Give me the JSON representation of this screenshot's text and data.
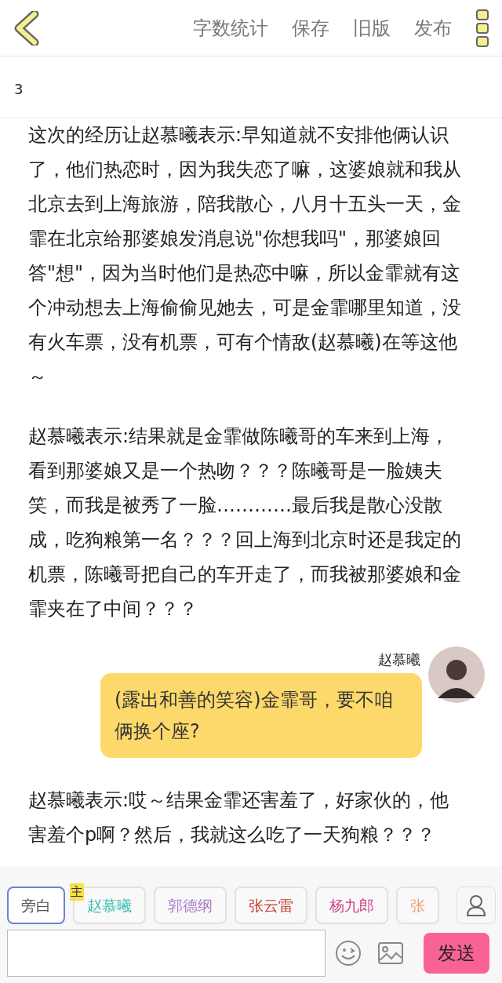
{
  "toolbar": {
    "actions": [
      "字数统计",
      "保存",
      "旧版",
      "发布"
    ]
  },
  "chapter": "3",
  "messages": [
    {
      "kind": "narration",
      "text": "这次的经历让赵慕曦表示:早知道就不安排他俩认识了，他们热恋时，因为我失恋了嘛，这婆娘就和我从北京去到上海旅游，陪我散心，八月十五头一天，金霏在北京给那婆娘发消息说\"你想我吗\"，那婆娘回答\"想\"，因为当时他们是热恋中嘛，所以金霏就有这个冲动想去上海偷偷见她去，可是金霏哪里知道，没有火车票，没有机票，可有个情敌(赵慕曦)在等这他～"
    },
    {
      "kind": "narration",
      "text": "赵慕曦表示:结果就是金霏做陈曦哥的车来到上海，看到那婆娘又是一个热吻？？？陈曦哥是一脸姨夫笑，而我是被秀了一脸…………最后我是散心没散成，吃狗粮第一名？？？回上海到北京时还是我定的机票，陈曦哥把自己的车开走了，而我被那婆娘和金霏夹在了中间？？？"
    },
    {
      "kind": "character",
      "name": "赵慕曦",
      "text": "(露出和善的笑容)金霏哥，要不咱俩换个座?"
    },
    {
      "kind": "narration",
      "text": "赵慕曦表示:哎～结果金霏还害羞了，好家伙的，他害羞个p啊？然后，我就这么吃了一天狗粮？？？"
    }
  ],
  "roles": [
    {
      "label": "旁白",
      "selected": true,
      "color": "#555555"
    },
    {
      "label": "赵慕曦",
      "selected": false,
      "color": "#3bbfb0",
      "badge": "主"
    },
    {
      "label": "郭德纲",
      "selected": false,
      "color": "#a77bc9"
    },
    {
      "label": "张云雷",
      "selected": false,
      "color": "#c0392b"
    },
    {
      "label": "杨九郎",
      "selected": false,
      "color": "#d0408a"
    },
    {
      "label": "张",
      "selected": false,
      "color": "#e8a070"
    }
  ],
  "composer": {
    "send": "发送"
  }
}
